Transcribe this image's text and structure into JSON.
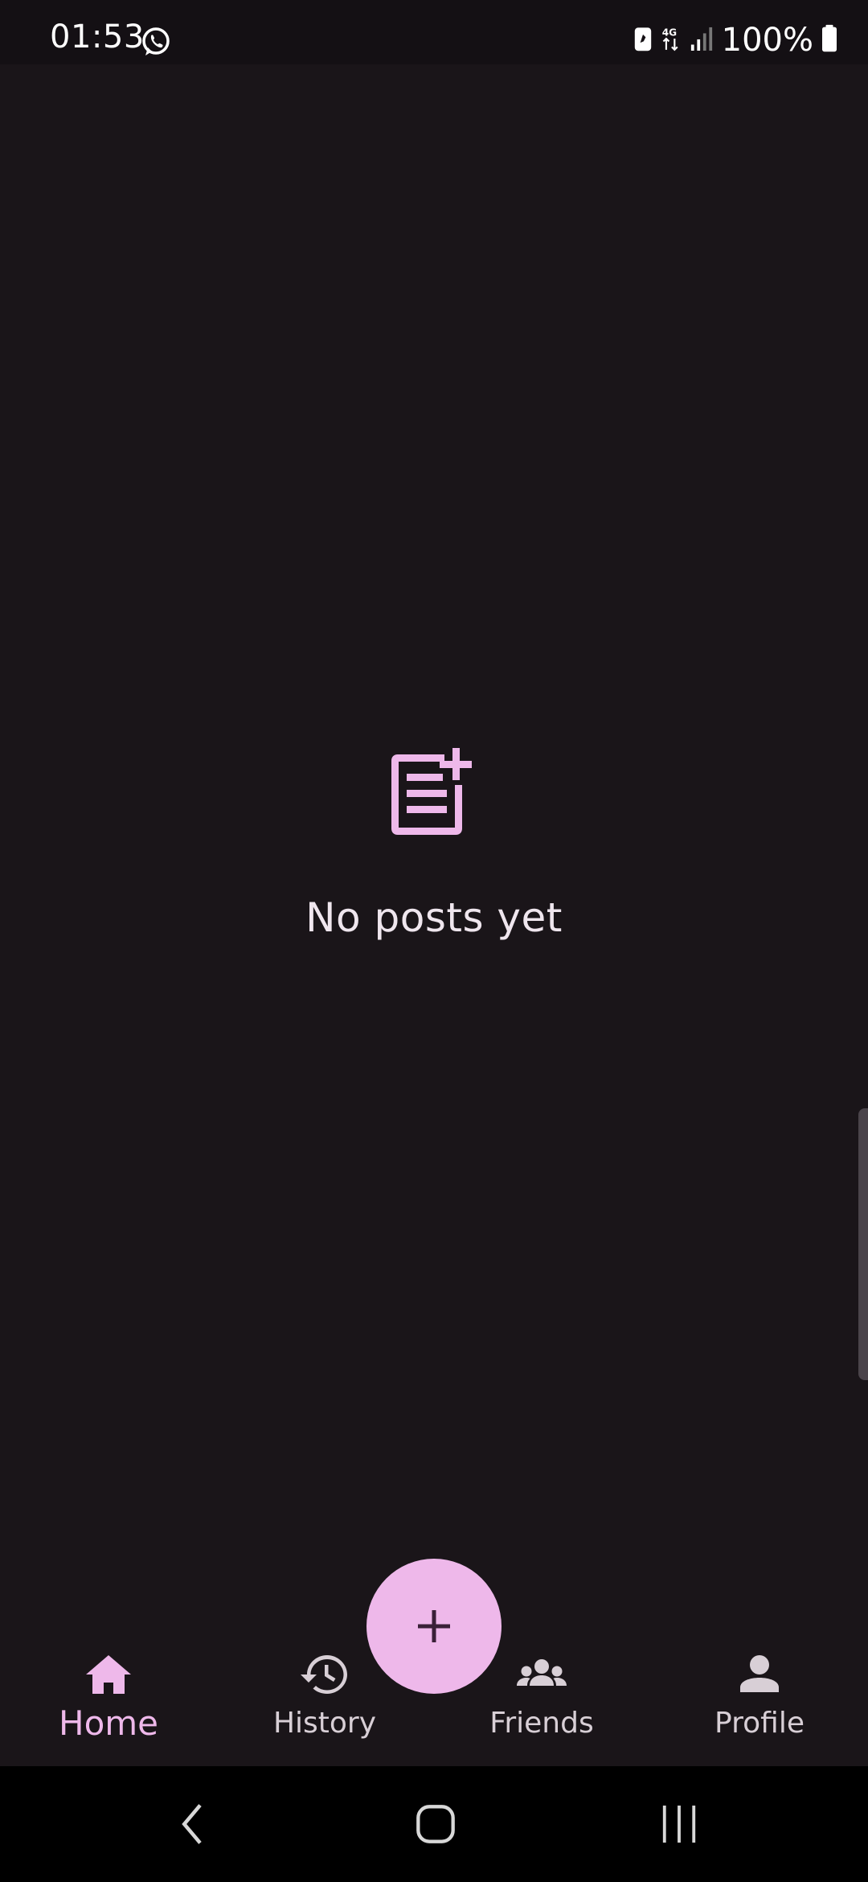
{
  "status_bar": {
    "time": "01:53",
    "battery_percent": "100%",
    "network": "4G",
    "icons": [
      "whatsapp-icon",
      "battery-saver-icon",
      "network-4g-icon",
      "signal-icon",
      "battery-icon"
    ]
  },
  "main": {
    "empty_icon": "post-add-icon",
    "empty_text": "No posts yet"
  },
  "fab": {
    "icon": "plus-icon"
  },
  "bottom_nav": {
    "items": [
      {
        "label": "Home",
        "icon": "home-icon",
        "active": true
      },
      {
        "label": "History",
        "icon": "history-icon",
        "active": false
      },
      {
        "label": "Friends",
        "icon": "friends-icon",
        "active": false
      },
      {
        "label": "Profile",
        "icon": "profile-icon",
        "active": false
      }
    ]
  },
  "system_nav": {
    "icons": [
      "back-icon",
      "home-circle-icon",
      "recents-icon"
    ]
  },
  "colors": {
    "background": "#1a1519",
    "accent": "#eeb8ea",
    "text": "#efe6ee",
    "muted": "#d8cfd6"
  }
}
